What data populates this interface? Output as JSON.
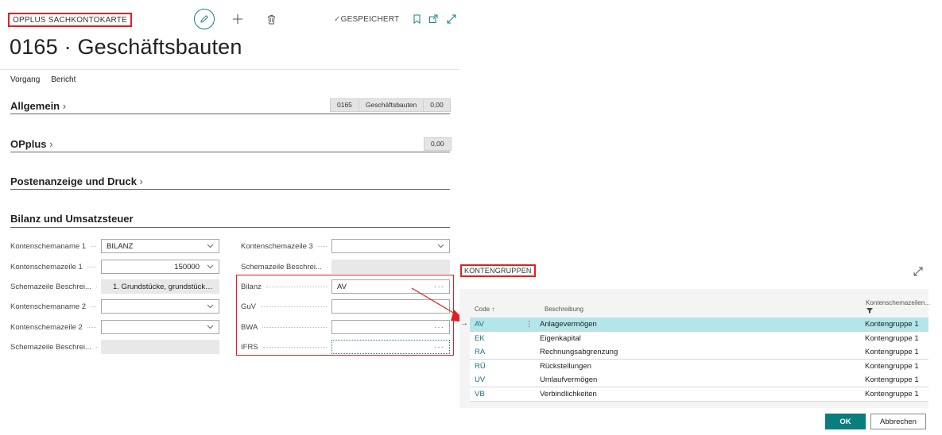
{
  "header": {
    "card_type": "OPPLUS SACHKONTOKARTE",
    "saved_label": "GESPEICHERT",
    "title": "0165 · Geschäftsbauten",
    "icons": [
      "edit-icon",
      "plus-icon",
      "delete-icon",
      "bookmark-icon",
      "open-new-icon",
      "expand-icon"
    ]
  },
  "menu": {
    "items": [
      "Vorgang",
      "Bericht"
    ]
  },
  "sections": {
    "allgemein": {
      "title": "Allgemein",
      "summary": [
        "0165",
        "Geschäftsbauten",
        "0,00"
      ]
    },
    "opplus": {
      "title": "OPplus",
      "summary": [
        "0,00"
      ]
    },
    "posten": {
      "title": "Postenanzeige und Druck"
    },
    "bilanz": {
      "title": "Bilanz und Umsatzsteuer"
    }
  },
  "fields": {
    "left": [
      {
        "label": "Kontenschemaname 1",
        "value": "BILANZ",
        "kind": "dropdown"
      },
      {
        "label": "Kontenschemazeile 1",
        "value": "150000",
        "kind": "dropdown"
      },
      {
        "label": "Schemazeile Beschrei...",
        "value": "1. Grundstücke, grundstücksg...",
        "kind": "readonly"
      },
      {
        "label": "Kontenschemaname 2",
        "value": "",
        "kind": "dropdown"
      },
      {
        "label": "Kontenschemazeile 2",
        "value": "",
        "kind": "dropdown"
      },
      {
        "label": "Schemazeile Beschrei...",
        "value": "",
        "kind": "readonly"
      }
    ],
    "right": [
      {
        "label": "Kontenschemazeile 3",
        "value": "",
        "kind": "dropdown"
      },
      {
        "label": "Schemazeile Beschrei...",
        "value": "",
        "kind": "readonly"
      },
      {
        "label": "Bilanz",
        "value": "AV",
        "kind": "lookup"
      },
      {
        "label": "GuV",
        "value": "",
        "kind": "lookup"
      },
      {
        "label": "BWA",
        "value": "",
        "kind": "lookup"
      },
      {
        "label": "IFRS",
        "value": "",
        "kind": "lookup"
      }
    ]
  },
  "lookup": {
    "title": "KONTENGRUPPEN",
    "columns": [
      "Code ↑",
      "Beschreibung",
      "Kontenschemazeilen..."
    ],
    "rows": [
      {
        "code": "AV",
        "desc": "Anlagevermögen",
        "group": "Kontengruppe 1",
        "selected": true
      },
      {
        "code": "EK",
        "desc": "Eigenkapital",
        "group": "Kontengruppe 1",
        "selected": false
      },
      {
        "code": "RA",
        "desc": "Rechnungsabgrenzung",
        "group": "Kontengruppe 1",
        "selected": false
      },
      {
        "code": "RÜ",
        "desc": "Rückstellungen",
        "group": "Kontengruppe 1",
        "selected": false
      },
      {
        "code": "UV",
        "desc": "Umlaufvermögen",
        "group": "Kontengruppe 1",
        "selected": false
      },
      {
        "code": "VB",
        "desc": "Verbindlichkeiten",
        "group": "Kontengruppe 1",
        "selected": false
      }
    ],
    "ok_label": "OK",
    "cancel_label": "Abbrechen"
  },
  "colors": {
    "accent": "#0a7d7d",
    "highlight": "#e02020",
    "selected_row": "#b3e6ea"
  }
}
